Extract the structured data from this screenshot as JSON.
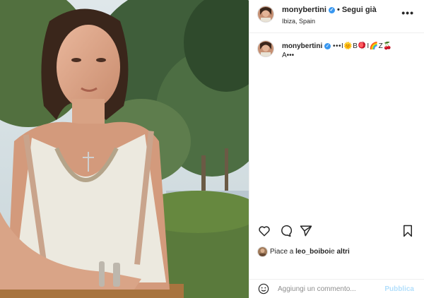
{
  "post": {
    "photo_desc_icon": "post-photo",
    "header": {
      "username": "monybertini",
      "separator": "•",
      "follow_label": "Segui già",
      "location": "Ibiza, Spain",
      "more_icon": "more-horizontal-icon",
      "more_label": "•••"
    },
    "caption": {
      "username": "monybertini",
      "text": "•••I🌞B🪀I🌈Z🍒",
      "more_line": "A•••"
    },
    "actions": {
      "like_icon": "heart-icon",
      "comment_icon": "comment-icon",
      "share_icon": "paper-plane-icon",
      "save_icon": "bookmark-icon"
    },
    "likes": {
      "prefix": "Piace a ",
      "user": "leo_boiboi",
      "suffix": " e ",
      "others": "altri"
    },
    "comment": {
      "placeholder": "Aggiungi un commento...",
      "publish_label": "Pubblica",
      "emoji_icon": "smiley-icon"
    }
  },
  "colors": {
    "verified": "#3897f0",
    "publish_disabled": "#b2dffc",
    "border": "#efefef",
    "text": "#262626",
    "muted": "#8e8e8e"
  }
}
